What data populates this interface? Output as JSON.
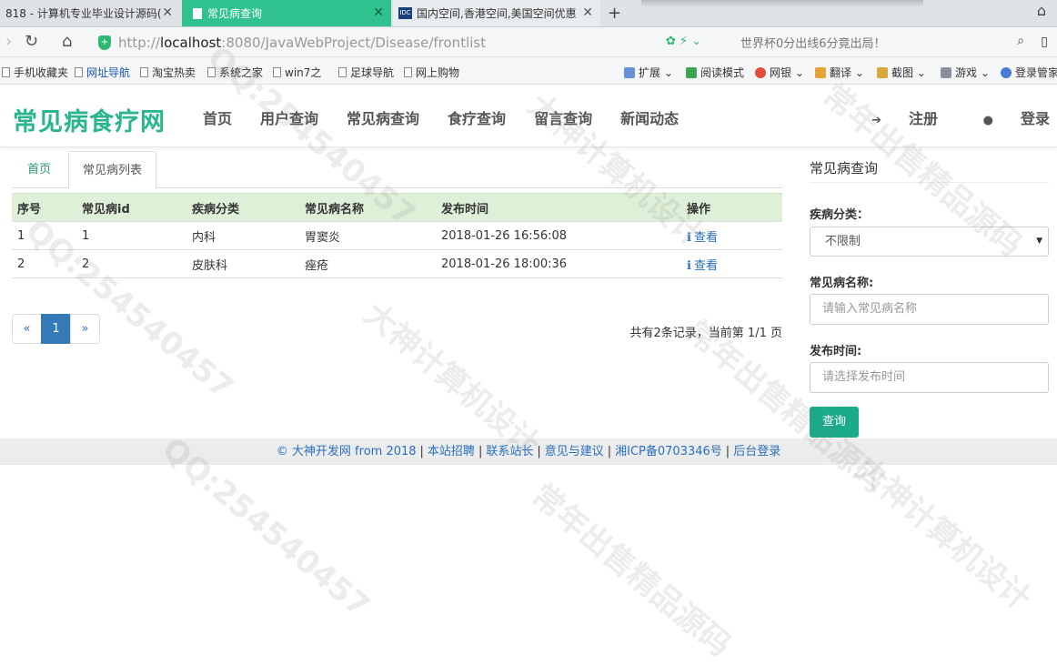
{
  "browser": {
    "tabs": [
      {
        "label": "818 - 计算机专业毕业设计源码(",
        "close": "✕"
      },
      {
        "label": "常见病查询",
        "close": "✕"
      },
      {
        "label": "国内空间,香港空间,美国空间优惠",
        "close": "✕"
      }
    ],
    "tab3_favicon": "IDC",
    "newtab": "+",
    "url_protocol": "http://",
    "url_host": "localhost",
    "url_path": ":8080/JavaWebProject/Disease/frontlist",
    "search_text": "世界杯0分出线6分竟出局！"
  },
  "bookmarks": [
    "手机收藏夹",
    "网址导航",
    "淘宝热卖",
    "系统之家",
    "win7之",
    "足球导航",
    "网上购物",
    "扩展",
    "阅读模式",
    "网银",
    "翻译",
    "截图",
    "游戏",
    "登录管家"
  ],
  "site": {
    "logo": "常见病食疗网",
    "nav": [
      "首页",
      "用户查询",
      "常见病查询",
      "食疗查询",
      "留言查询",
      "新闻动态"
    ],
    "register": "注册",
    "login": "登录"
  },
  "content": {
    "breadcrumb_home": "首页",
    "breadcrumb_active": "常见病列表",
    "columns": [
      "序号",
      "常见病id",
      "疾病分类",
      "常见病名称",
      "发布时间",
      "操作"
    ],
    "rows": [
      {
        "no": "1",
        "id": "1",
        "category": "内科",
        "name": "胃窦炎",
        "time": "2018-01-26 16:56:08",
        "action": "查看"
      },
      {
        "no": "2",
        "id": "2",
        "category": "皮肤科",
        "name": "痤疮",
        "time": "2018-01-26 18:00:36",
        "action": "查看"
      }
    ],
    "pager": {
      "prev": "«",
      "current": "1",
      "next": "»"
    },
    "pager_info": "共有2条记录，当前第 1/1 页"
  },
  "sidebar": {
    "title": "常见病查询",
    "category_label": "疾病分类：",
    "category_value": "不限制",
    "name_label": "常见病名称:",
    "name_placeholder": "请输入常见病名称",
    "time_label": "发布时间:",
    "time_placeholder": "请选择发布时间",
    "query_button": "查询"
  },
  "footer": {
    "links": [
      "© 大神开发网 from 2018",
      "本站招聘",
      "联系站长",
      "意见与建议",
      "湘ICP备0703346号",
      "后台登录"
    ],
    "separator": "|"
  },
  "watermarks": [
    "大神计算机设计",
    "QQ:254540457",
    "常年出售精品源码"
  ]
}
